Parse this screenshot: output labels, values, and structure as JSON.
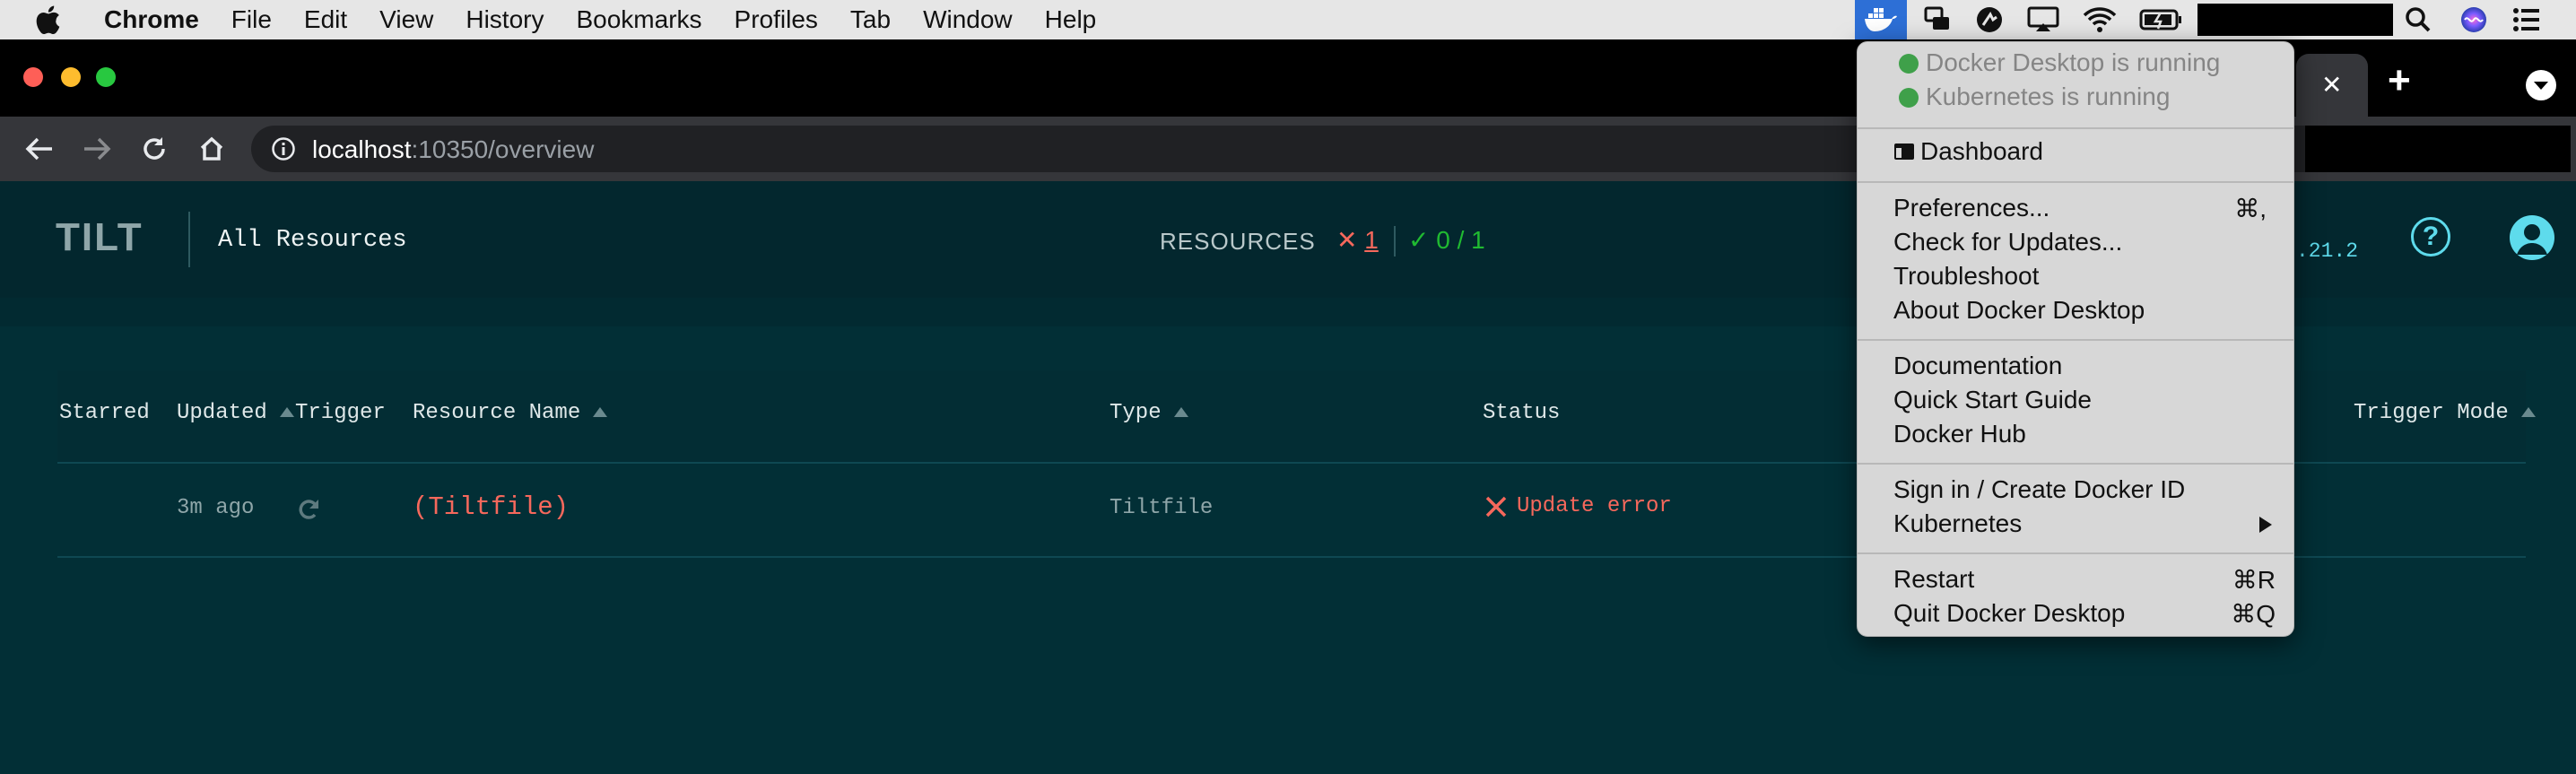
{
  "menubar": {
    "app": "Chrome",
    "items": [
      "File",
      "Edit",
      "View",
      "History",
      "Bookmarks",
      "Profiles",
      "Tab",
      "Window",
      "Help"
    ]
  },
  "browser": {
    "url_host": "localhost",
    "url_path": ":10350/overview",
    "tab_close": "✕",
    "tab_new": "+"
  },
  "tilt": {
    "logo": "TILT",
    "page_title": "All Resources",
    "resources_label": "RESOURCES",
    "error_count": "1",
    "ok_count": "0 / 1",
    "version": ".21.2",
    "columns": {
      "starred": "Starred",
      "updated": "Updated",
      "trigger": "Trigger",
      "resource_name": "Resource Name",
      "type": "Type",
      "status": "Status",
      "trigger_mode": "Trigger Mode"
    },
    "row": {
      "updated": "3m ago",
      "name": "(Tiltfile)",
      "type": "Tiltfile",
      "status": "Update error"
    }
  },
  "docker_menu": {
    "status_desktop": "Docker Desktop is running",
    "status_kubernetes": "Kubernetes is running",
    "dashboard": "Dashboard",
    "preferences": "Preferences...",
    "preferences_shortcut": "⌘,",
    "check_updates": "Check for Updates...",
    "troubleshoot": "Troubleshoot",
    "about": "About Docker Desktop",
    "documentation": "Documentation",
    "quick_start": "Quick Start Guide",
    "docker_hub": "Docker Hub",
    "sign_in": "Sign in / Create Docker ID",
    "kubernetes": "Kubernetes",
    "restart": "Restart",
    "restart_shortcut": "⌘R",
    "quit": "Quit Docker Desktop",
    "quit_shortcut": "⌘Q"
  },
  "colors": {
    "tilt_bg": "#022f36",
    "tilt_header": "#03272e",
    "error": "#f6685c",
    "ok": "#20ba31",
    "accent": "#5edbec"
  }
}
